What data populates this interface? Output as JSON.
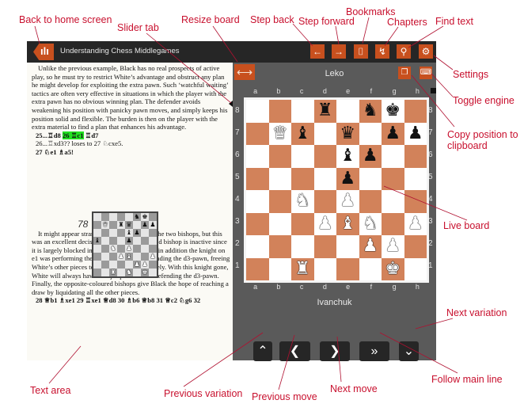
{
  "callouts": {
    "back_home": "Back to home screen",
    "slider_tab": "Slider tab",
    "resize_board": "Resize board",
    "step_back": "Step back",
    "step_forward": "Step forward",
    "bookmarks": "Bookmarks",
    "chapters": "Chapters",
    "find_text": "Find text",
    "settings": "Settings",
    "toggle_engine": "Toggle engine",
    "copy_position": "Copy position to",
    "copy_position_2": "clipboard",
    "live_board": "Live board",
    "next_variation": "Next variation",
    "follow_main_line": "Follow main line",
    "next_move": "Next move",
    "previous_move": "Previous move",
    "previous_variation": "Previous variation",
    "text_area": "Text area"
  },
  "topbar": {
    "home_icon": "ılı",
    "title": "Understanding Chess Middlegames",
    "icons": {
      "step_back": "←",
      "step_forward": "→",
      "bookmarks": "⌷",
      "chapters": "↯",
      "find": "⚲",
      "settings": "⚙"
    }
  },
  "text": {
    "para1": "Unlike the previous example, Black has no real prospects of active play, so he must try to restrict White’s advantage and obstruct any plan he might develop for exploiting the extra pawn. Such ‘watchful waiting’ tactics are often very effective in situations in which the player with the extra pawn has no obvious winning plan. The defender avoids weakening his position with panicky pawn moves, and simply keeps his position solid and flexible. The burden is then on the player with the extra material to find a plan that enhances his advantage.",
    "move_line1_a": "25...♖d8 ",
    "move_line1_hl": "26 ♖c1",
    "move_line1_b": " ♖d7",
    "move_line2": "26...♖xd3?? loses to 27 ♘cxe5.",
    "move_line3": "27 ♘e1 ♗a5!",
    "diagram_number": "78",
    "para2": "It might appear strange to exchange one of the two bishops, but this was an excellent decision. Black’s dark-squared bishop is inactive since it is largely blocked in by friendly pawns, and in addition the knight on e1 was performing the useful function of defending the d3-pawn, freeing White’s other pieces to manoeuvre more actively. With this knight gone, White will always have a major piece tied to defending the d3-pawn. Finally, the opposite-coloured bishops give Black the hope of reaching a draw by liquidating all the other pieces.",
    "move_line4": "28 ♕b1 ♗xe1 29 ♖xe1 ♕d8 30 ♗b6 ♕b8 31 ♕c2 ♘g6 32"
  },
  "board": {
    "resize_icon": "⟷",
    "top_player": "Leko",
    "bottom_player": "Ivanchuk",
    "copy_icon": "❐",
    "engine_icon": "⌨",
    "files": [
      "a",
      "b",
      "c",
      "d",
      "e",
      "f",
      "g",
      "h"
    ],
    "ranks": [
      "8",
      "7",
      "6",
      "5",
      "4",
      "3",
      "2",
      "1"
    ],
    "position": [
      [
        "",
        "",
        "",
        "r",
        "",
        "n",
        "k",
        ""
      ],
      [
        "",
        "Q",
        "b",
        "",
        "q",
        "",
        "p",
        "p"
      ],
      [
        "",
        "",
        "",
        "",
        "b",
        "p",
        "",
        ""
      ],
      [
        "",
        "",
        "",
        "",
        "p",
        "",
        "",
        ""
      ],
      [
        "",
        "",
        "N",
        "",
        "P",
        "",
        "",
        ""
      ],
      [
        "",
        "",
        "",
        "P",
        "B",
        "N",
        "",
        "P"
      ],
      [
        "",
        "",
        "",
        "",
        "",
        "P",
        "P",
        ""
      ],
      [
        "",
        "",
        "R",
        "",
        "",
        "",
        "K",
        ""
      ]
    ],
    "mini_position": [
      [
        "",
        "",
        "",
        "",
        "",
        "n",
        "k",
        ""
      ],
      [
        "",
        "Q",
        "",
        "r",
        "q",
        "",
        "p",
        "p"
      ],
      [
        "",
        "",
        "",
        "",
        "b",
        "p",
        "",
        ""
      ],
      [
        "b",
        "",
        "",
        "",
        "p",
        "",
        "",
        ""
      ],
      [
        "",
        "",
        "N",
        "",
        "P",
        "",
        "",
        ""
      ],
      [
        "",
        "",
        "",
        "P",
        "B",
        "",
        "",
        "P"
      ],
      [
        "",
        "",
        "",
        "",
        "",
        "P",
        "P",
        ""
      ],
      [
        "",
        "",
        "R",
        "",
        "N",
        "",
        "K",
        ""
      ]
    ]
  },
  "nav": {
    "previous_variation": "⌃",
    "previous_move": "❮",
    "next_move": "❯",
    "follow_main_line": "»",
    "next_variation": "⌄"
  },
  "colors": {
    "accent": "#c8501e",
    "dark_square": "#d2825a",
    "light_square": "#ffffff",
    "callout": "#c8102e",
    "highlight": "#22e022"
  }
}
